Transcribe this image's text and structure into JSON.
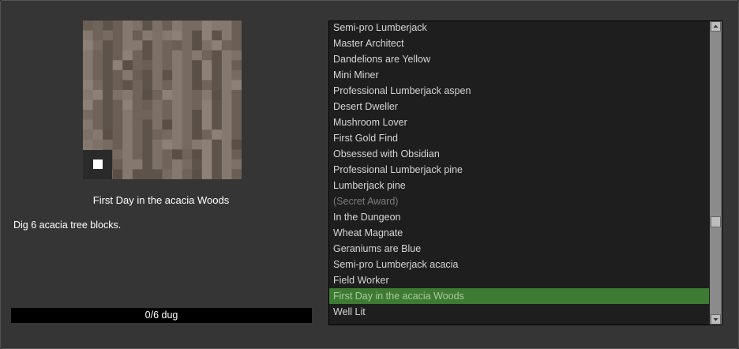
{
  "achievement": {
    "title": "First Day in the acacia Woods",
    "description": "Dig 6 acacia tree blocks.",
    "progress_label": "0/6 dug",
    "progress_fraction": 0,
    "icon": "acacia-log-texture-icon",
    "locked_indicator": "locked-square-icon"
  },
  "list": {
    "items": [
      {
        "label": "Semi-pro Lumberjack",
        "state": "normal"
      },
      {
        "label": "Master Architect",
        "state": "normal"
      },
      {
        "label": "Dandelions are Yellow",
        "state": "normal"
      },
      {
        "label": "Mini Miner",
        "state": "normal"
      },
      {
        "label": "Professional Lumberjack aspen",
        "state": "normal"
      },
      {
        "label": "Desert Dweller",
        "state": "normal"
      },
      {
        "label": "Mushroom Lover",
        "state": "normal"
      },
      {
        "label": "First Gold Find",
        "state": "normal"
      },
      {
        "label": "Obsessed with Obsidian",
        "state": "normal"
      },
      {
        "label": "Professional Lumberjack pine",
        "state": "normal"
      },
      {
        "label": "Lumberjack pine",
        "state": "normal"
      },
      {
        "label": "(Secret Award)",
        "state": "secret"
      },
      {
        "label": "In the Dungeon",
        "state": "normal"
      },
      {
        "label": "Wheat Magnate",
        "state": "normal"
      },
      {
        "label": "Geraniums are Blue",
        "state": "normal"
      },
      {
        "label": "Semi-pro Lumberjack acacia",
        "state": "normal"
      },
      {
        "label": "Field Worker",
        "state": "normal"
      },
      {
        "label": "First Day in the acacia Woods",
        "state": "selected"
      },
      {
        "label": "Well Lit",
        "state": "normal"
      }
    ],
    "scroll_position": 0.68
  },
  "colors": {
    "selected_row": "#3d7a32",
    "panel_bg": "#353535",
    "list_bg": "#1e1e1e"
  }
}
